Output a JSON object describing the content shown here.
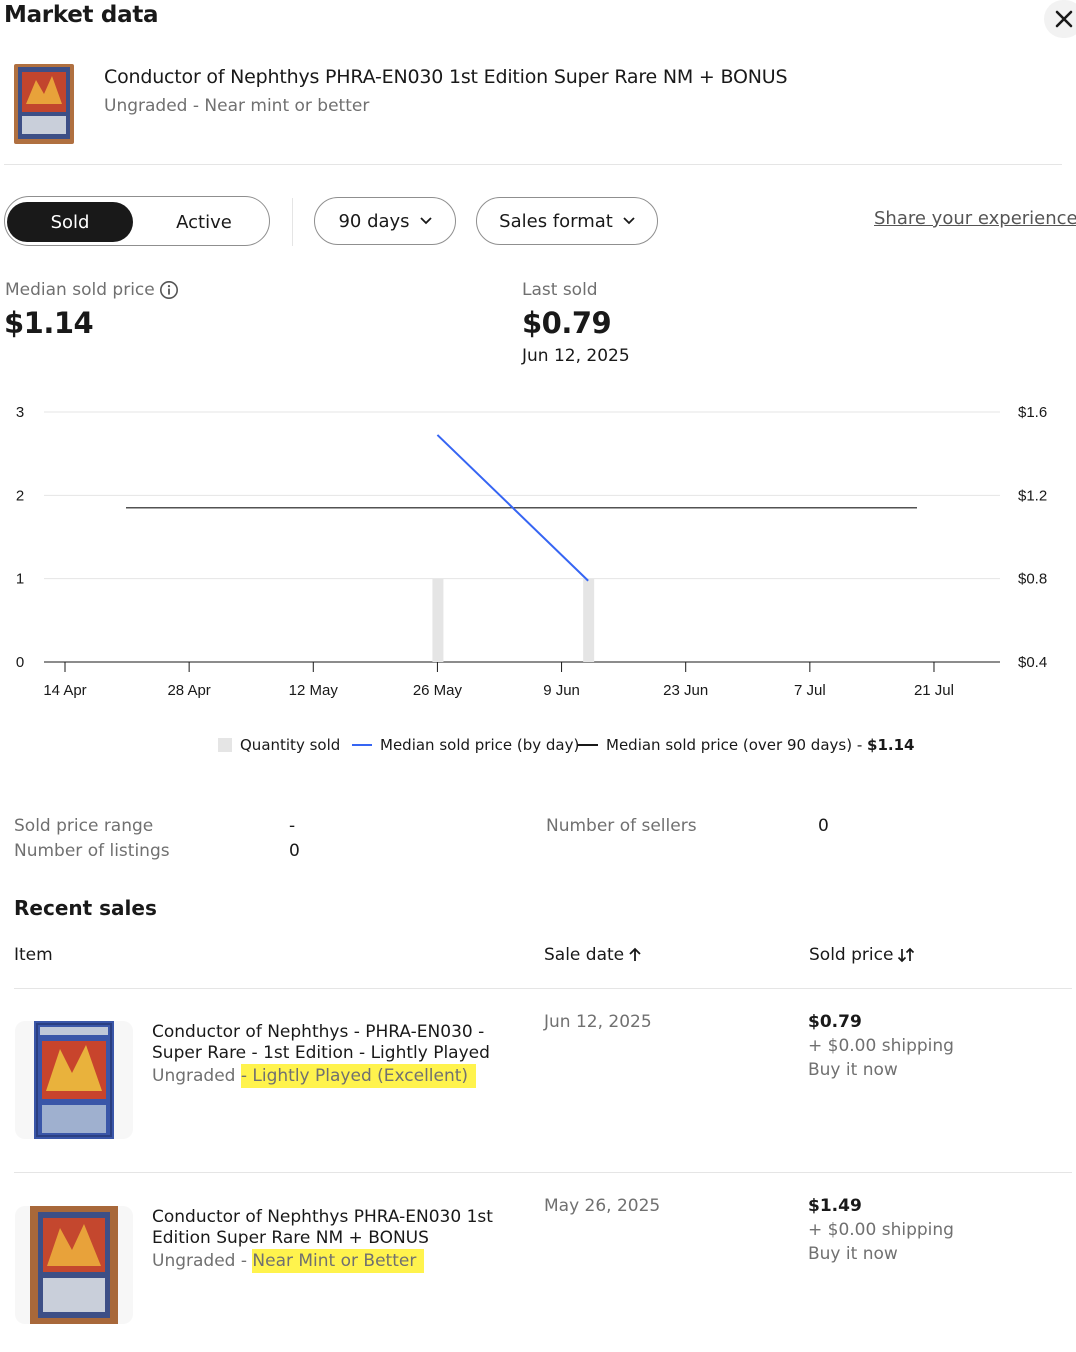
{
  "header": {
    "title": "Market data",
    "close_icon": "close-icon"
  },
  "product": {
    "title": "Conductor of Nephthys PHRA-EN030 1st Edition Super Rare NM + BONUS",
    "subtitle": "Ungraded - Near mint or better"
  },
  "filters": {
    "toggle": [
      "Sold",
      "Active"
    ],
    "selected_toggle": "Sold",
    "range_label": "90 days",
    "format_label": "Sales format",
    "share_link": "Share your experience"
  },
  "summary": {
    "median_label": "Median sold price",
    "median_value": "$1.14",
    "last_label": "Last sold",
    "last_value": "$0.79",
    "last_date": "Jun 12, 2025"
  },
  "chart_data": {
    "type": "bar",
    "x_ticks": [
      "14 Apr",
      "28 Apr",
      "12 May",
      "26 May",
      "9 Jun",
      "23 Jun",
      "7 Jul",
      "21 Jul"
    ],
    "y_left_ticks": [
      "0",
      "1",
      "2",
      "3"
    ],
    "y_left_range": [
      0,
      3
    ],
    "y_right_ticks": [
      "$0.4",
      "$0.8",
      "$1.2",
      "$1.6"
    ],
    "y_right_range": [
      0.4,
      1.6
    ],
    "grid": "horizontal",
    "legend_position": "bottom",
    "series": [
      {
        "name": "Quantity sold",
        "type": "bar",
        "axis": "left",
        "color": "#e5e5e5",
        "points": [
          {
            "date": "26 May",
            "value": 1
          },
          {
            "date": "12 Jun",
            "value": 1
          }
        ]
      },
      {
        "name": "Median sold price (by day)",
        "type": "line",
        "axis": "right",
        "color": "#3665f3",
        "points": [
          {
            "date": "26 May",
            "value": 1.49
          },
          {
            "date": "12 Jun",
            "value": 0.79
          }
        ]
      },
      {
        "name": "Median sold price (over 90 days)",
        "type": "line",
        "axis": "right",
        "color": "#191919",
        "value": 1.14,
        "value_label": "$1.14"
      }
    ]
  },
  "legend": {
    "quantity": "Quantity sold",
    "daily": "Median sold price (by day)",
    "overall": "Median sold price (over 90 days) - ",
    "overall_value": "$1.14"
  },
  "stats": {
    "range_label": "Sold price range",
    "range_value": "-",
    "listings_label": "Number of listings",
    "listings_value": "0",
    "sellers_label": "Number of sellers",
    "sellers_value": "0"
  },
  "recent": {
    "title": "Recent sales",
    "columns": {
      "item": "Item",
      "date": "Sale date",
      "price": "Sold price"
    },
    "rows": [
      {
        "title": "Conductor of Nephthys - PHRA-EN030 - Super Rare - 1st Edition - Lightly Played",
        "grade": "Ungraded",
        "condition": "- Lightly Played (Excellent)",
        "date": "Jun 12, 2025",
        "price": "$0.79",
        "shipping": "+ $0.00 shipping",
        "format": "Buy it now"
      },
      {
        "title": "Conductor of Nephthys PHRA-EN030 1st Edition Super Rare NM + BONUS",
        "grade": "Ungraded -",
        "condition": " Near Mint or Better",
        "date": "May 26, 2025",
        "price": "$1.49",
        "shipping": "+ $0.00 shipping",
        "format": "Buy it now"
      }
    ]
  }
}
